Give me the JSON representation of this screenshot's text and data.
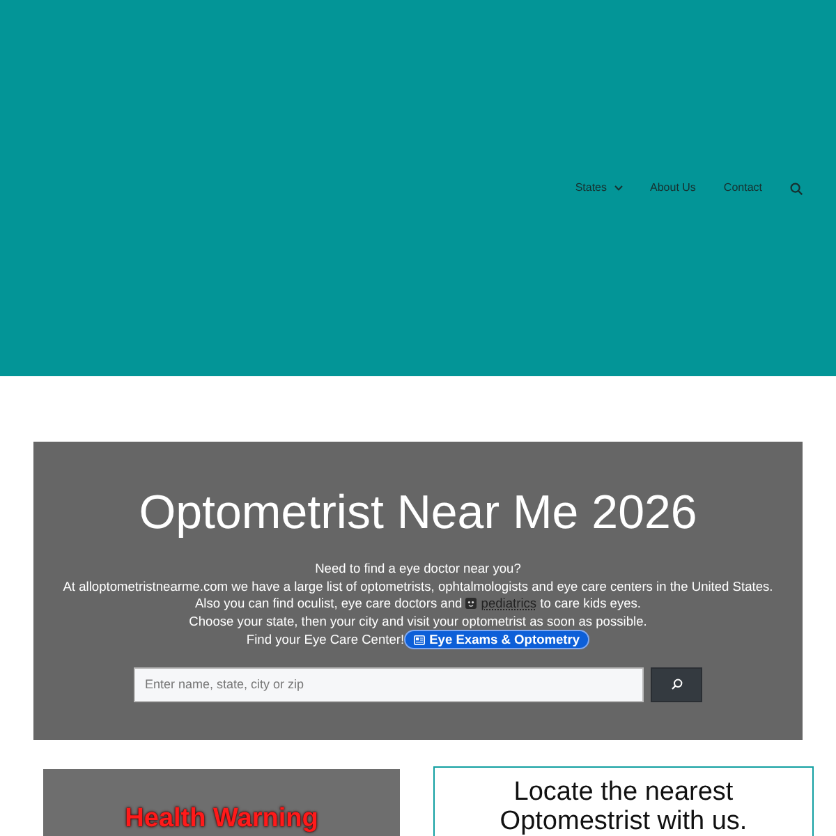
{
  "nav": {
    "items": [
      {
        "kind": "dropdown",
        "label": "States"
      },
      {
        "kind": "link",
        "label": "About Us"
      },
      {
        "kind": "link",
        "label": "Contact"
      },
      {
        "kind": "search"
      }
    ]
  },
  "hero": {
    "title": "Optometrist Near Me 2026",
    "lines": [
      {
        "text": "Need to find a eye doctor near you?"
      },
      {
        "text": "At alloptometristnearme.com we have a large list of optometrists, ophtalmologists and eye care centers in the United States."
      },
      {
        "text": "Also you can find oculist, eye care doctors and",
        "link": "pediatrics",
        "after": "to care kids eyes."
      },
      {
        "text": "Choose your state, then your city and visit your optometrist as soon as possible."
      },
      {
        "text": "Find your Eye Care Center!",
        "badge": "Eye Exams & Optometry"
      }
    ],
    "search": {
      "placeholder": "Enter name, state, city or zip"
    }
  },
  "panels": [
    {
      "kind": "warning",
      "title": "Health Warning"
    },
    {
      "kind": "locate",
      "title": "Locate the nearest Optomestrist with us."
    }
  ]
}
